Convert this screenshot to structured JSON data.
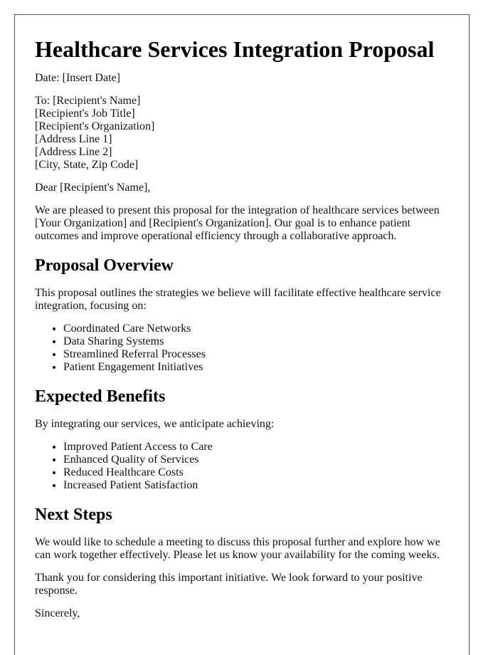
{
  "title": "Healthcare Services Integration Proposal",
  "date_line": "Date: [Insert Date]",
  "recipient": [
    "To: [Recipient's Name]",
    "[Recipient's Job Title]",
    "[Recipient's Organization]",
    "[Address Line 1]",
    "[Address Line 2]",
    "[City, State, Zip Code]"
  ],
  "salutation": "Dear [Recipient's Name],",
  "intro": "We are pleased to present this proposal for the integration of healthcare services between [Your Organization] and [Recipient's Organization]. Our goal is to enhance patient outcomes and improve operational efficiency through a collaborative approach.",
  "sections": [
    {
      "heading": "Proposal Overview",
      "text": "This proposal outlines the strategies we believe will facilitate effective healthcare service integration, focusing on:",
      "items": [
        "Coordinated Care Networks",
        "Data Sharing Systems",
        "Streamlined Referral Processes",
        "Patient Engagement Initiatives"
      ]
    },
    {
      "heading": "Expected Benefits",
      "text": "By integrating our services, we anticipate achieving:",
      "items": [
        "Improved Patient Access to Care",
        "Enhanced Quality of Services",
        "Reduced Healthcare Costs",
        "Increased Patient Satisfaction"
      ]
    },
    {
      "heading": "Next Steps",
      "text": "We would like to schedule a meeting to discuss this proposal further and explore how we can work together effectively. Please let us know your availability for the coming weeks."
    }
  ],
  "closing_text": "Thank you for considering this important initiative. We look forward to your positive response.",
  "sign_off": "Sincerely,"
}
